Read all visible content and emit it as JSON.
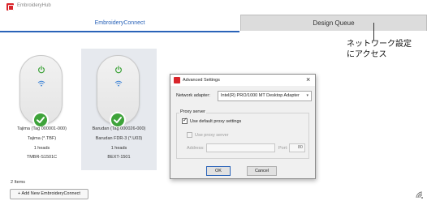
{
  "app": {
    "title": "EmbroideryHub"
  },
  "tabs": {
    "active_label": "EmbroideryConnect",
    "inactive_label": "Design Queue"
  },
  "callout": {
    "text": "ネットワーク設定\nにアクセス"
  },
  "devices": [
    {
      "name_line": "Tajima   (Tag 000001-000)",
      "model_line": "Tajima (*.TBF)",
      "heads_line": "1 heads",
      "serial_line": "TMBR-S1501C",
      "status": "connected",
      "selected": false
    },
    {
      "name_line": "Barudan   (Tag 000026-000)",
      "model_line": "Barudan FDR-3 (*.U03)",
      "heads_line": "1 heads",
      "serial_line": "BEXT-1501",
      "status": "connected",
      "selected": true
    }
  ],
  "footer": {
    "items_count": "2 Items",
    "add_button": "+ Add New EmbroideryConnect"
  },
  "dialog": {
    "title": "Advanced Settings",
    "network_adapter_label": "Network adapter:",
    "network_adapter_value": "Intel(R) PRO/1000 MT Desktop Adapter",
    "proxy_group_label": "Proxy server",
    "use_default_proxy_label": "Use default proxy settings",
    "use_default_proxy_checked": true,
    "use_proxy_label": "Use proxy server",
    "use_proxy_checked": false,
    "address_label": "Address:",
    "address_value": "",
    "port_label": "Port:",
    "port_value": "80",
    "ok_label": "OK",
    "cancel_label": "Cancel",
    "close_glyph": "×"
  },
  "colors": {
    "accent": "#2a63b8",
    "brand_red": "#d9252b",
    "status_green": "#3ea33a",
    "card_selected_bg": "#e6e9ee"
  }
}
